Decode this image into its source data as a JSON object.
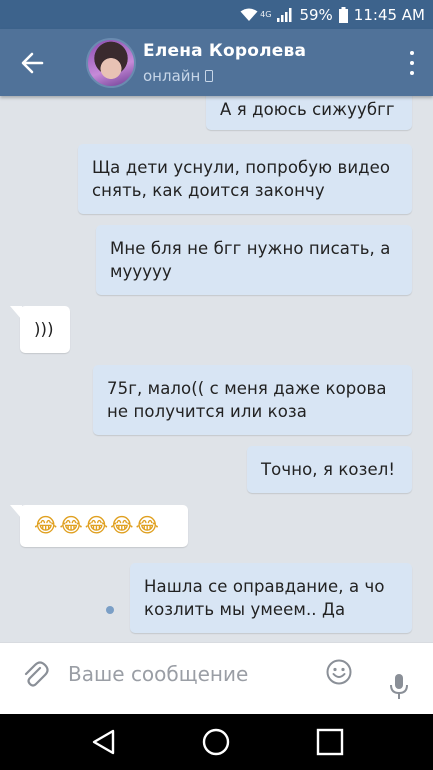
{
  "status_bar": {
    "network_label": "4G",
    "battery": "59%",
    "time": "11:45 AM"
  },
  "header": {
    "contact_name": "Елена Королева",
    "contact_status": "онлайн"
  },
  "messages": [
    {
      "direction": "out",
      "text": "А я доюсь сижуубгг"
    },
    {
      "direction": "out",
      "text": "Ща дети уснули, попробую видео снять, как доится закончу"
    },
    {
      "direction": "out",
      "text": "Мне бля не бгг нужно писать, а муууyy"
    },
    {
      "direction": "in",
      "text": ")))"
    },
    {
      "direction": "out",
      "text": "75г, мало(( с меня даже корова не получится или коза"
    },
    {
      "direction": "out",
      "text": "Точно, я козел!"
    },
    {
      "direction": "in",
      "text": "😂😂😂😂😂"
    },
    {
      "direction": "out",
      "text": "Нашла се оправдание, а чо козлить мы умеем.. Да",
      "unread": true
    }
  ],
  "composer": {
    "placeholder": "Ваше сообщение"
  },
  "icons": {
    "back": "arrow-left-icon",
    "menu": "more-vertical-icon",
    "attach": "paperclip-icon",
    "emoji": "smiley-icon",
    "mic": "microphone-icon",
    "nav_back": "triangle-back-icon",
    "nav_home": "circle-home-icon",
    "nav_recent": "square-recent-icon"
  },
  "colors": {
    "header": "#507299",
    "status_bar": "#3d638c",
    "outgoing_bubble": "#d8e5f4",
    "incoming_bubble": "#ffffff",
    "background": "#dfe3e8"
  }
}
